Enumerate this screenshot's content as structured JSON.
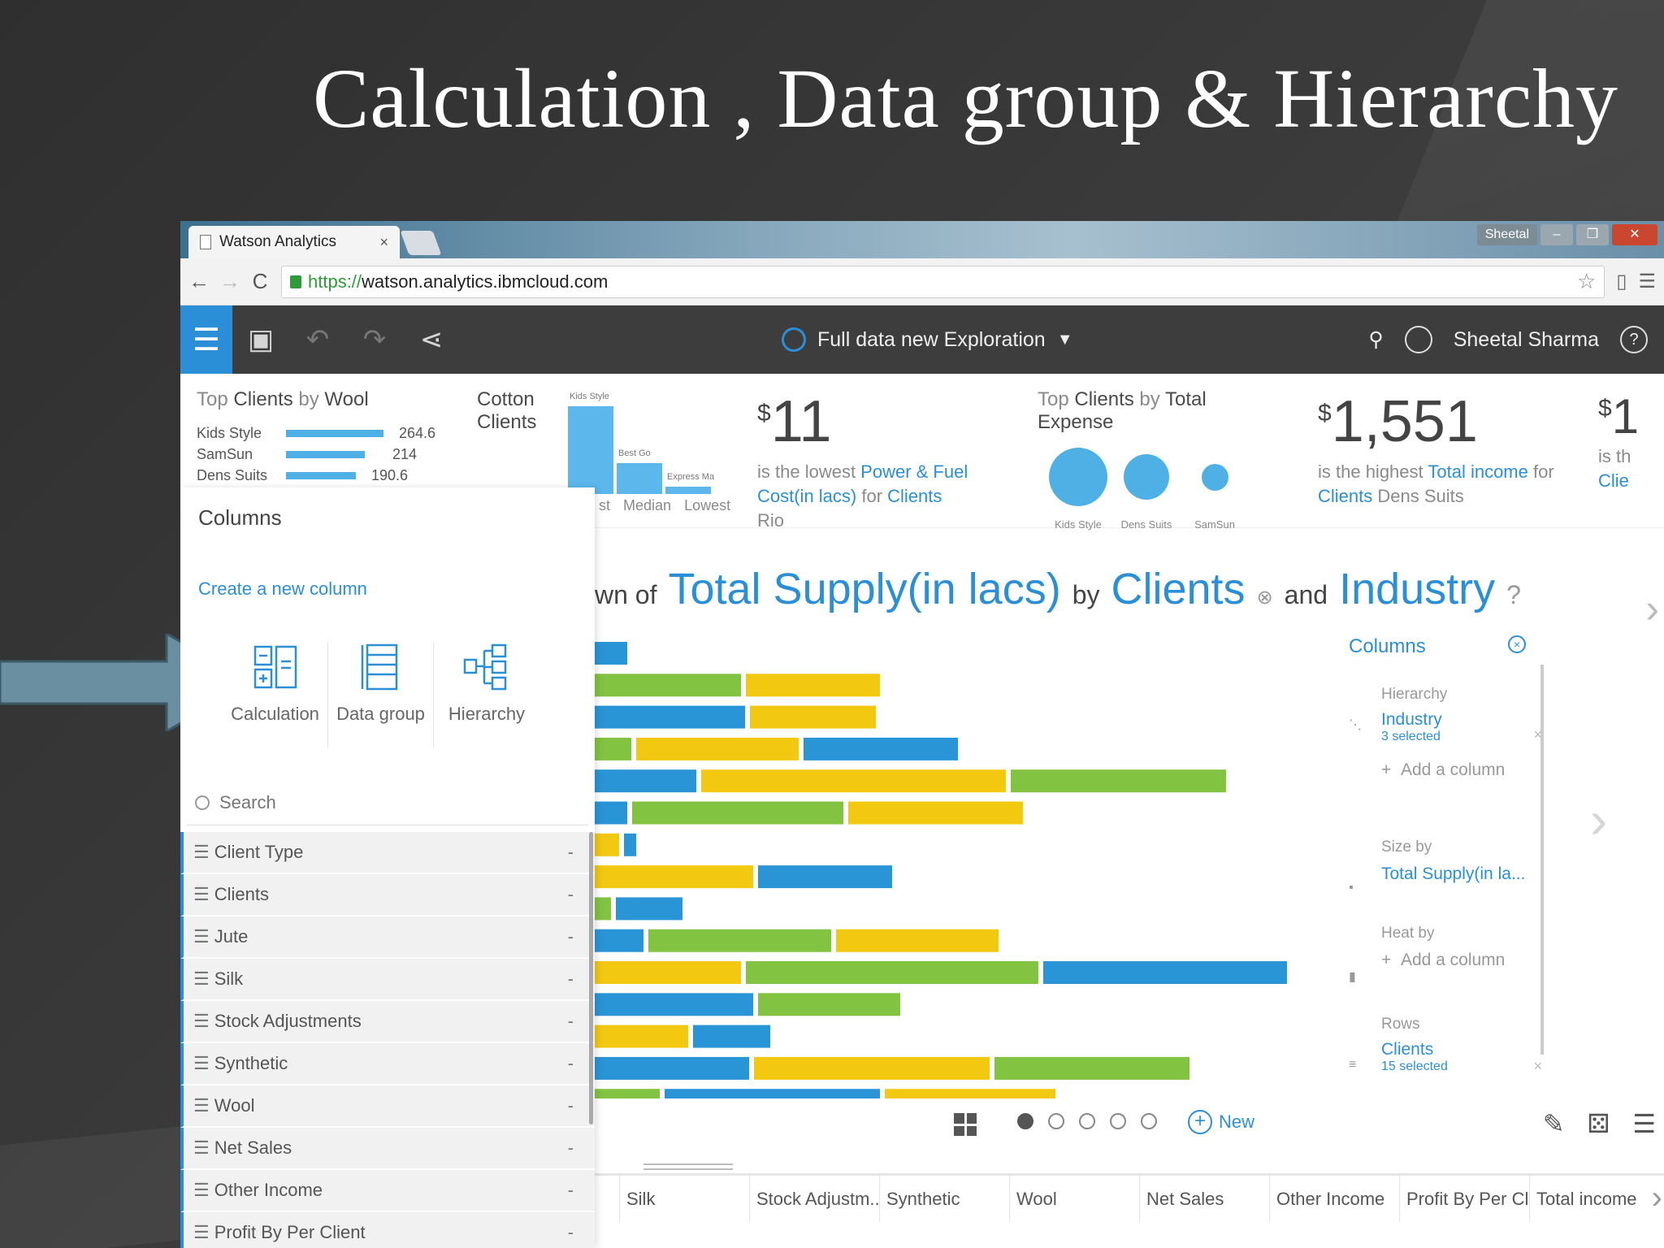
{
  "slide": {
    "title": "Calculation , Data group & Hierarchy"
  },
  "browser": {
    "tab_title": "Watson Analytics",
    "tab_close": "×",
    "user_badge": "Sheetal",
    "url_https": "https://",
    "url_rest": "watson.analytics.ibmcloud.com"
  },
  "header": {
    "exploration_title": "Full data new Exploration",
    "user_name": "Sheetal Sharma",
    "help": "?"
  },
  "insights": {
    "card1": {
      "title_pre": "Top ",
      "title_a": "Clients",
      "title_mid": " by ",
      "title_b": "Wool",
      "rows": [
        {
          "label": "Kids Style",
          "value": "264.6",
          "width": 1.0
        },
        {
          "label": "SamSun",
          "value": "214",
          "width": 0.81
        },
        {
          "label": "Dens Suits",
          "value": "190.6",
          "width": 0.72
        }
      ]
    },
    "card2": {
      "title_a": "Cotton",
      "title_mid": " by",
      "title_b": "Clients",
      "bars": [
        {
          "label": "Kids Style",
          "value": 1.0
        },
        {
          "label": "Best Go",
          "value": 0.35
        },
        {
          "label": "Express Ma",
          "value": 0.08
        }
      ],
      "axis": [
        "st",
        "Median",
        "Lowest"
      ]
    },
    "card3": {
      "symbol": "$",
      "value": "11",
      "text1": "is the lowest ",
      "measure1": "Power & Fuel",
      "measure2": "Cost(in lacs)",
      "text2": " for ",
      "dim": "Clients",
      "entity": " Rio"
    },
    "card4": {
      "title_pre": "Top ",
      "title_a": "Clients",
      "title_mid": " by ",
      "title_b": "Total Expense",
      "bubbles": [
        {
          "label": "Kids Style",
          "value": 1.0
        },
        {
          "label": "Dens Suits",
          "value": 0.7
        },
        {
          "label": "SamSun",
          "value": 0.25
        }
      ]
    },
    "card5": {
      "symbol": "$",
      "value": "1,551",
      "text1": "is the highest ",
      "measure": "Total income",
      "text2": " for",
      "dim": "Clients",
      "entity": " Dens Suits"
    },
    "card6": {
      "symbol": "$",
      "value": "1",
      "text1": "is th",
      "dim": "Clie"
    }
  },
  "left_panel": {
    "title": "Columns",
    "create_link": "Create a new column",
    "tools": [
      {
        "name": "calculation",
        "label": "Calculation"
      },
      {
        "name": "data-group",
        "label": "Data group"
      },
      {
        "name": "hierarchy",
        "label": "Hierarchy"
      }
    ],
    "search_placeholder": "Search",
    "columns": [
      "Client Type",
      "Clients",
      "Jute",
      "Silk",
      "Stock Adjustments",
      "Synthetic",
      "Wool",
      "Net Sales",
      "Other Income",
      "Profit By Per Client"
    ]
  },
  "question": {
    "prefix": "wn of",
    "measure": "Total Supply(in lacs)",
    "by": "by",
    "dim1": "Clients",
    "remove": "⊗",
    "and": "and",
    "dim2": "Industry",
    "q": "?"
  },
  "colors": {
    "blue": "#2b8fd8",
    "bar_blue": "#2a95d6",
    "bar_green": "#82c341",
    "bar_yellow": "#f2c811"
  },
  "chart_data": {
    "type": "bar",
    "orientation": "horizontal-stacked",
    "note_visible": "bars partially hidden behind the left panel",
    "rows": [
      [
        {
          "c": "blue",
          "v": 40
        }
      ],
      [
        {
          "c": "green",
          "v": 180
        },
        {
          "c": "yellow",
          "v": 165
        }
      ],
      [
        {
          "c": "blue",
          "v": 185
        },
        {
          "c": "yellow",
          "v": 155
        }
      ],
      [
        {
          "c": "green",
          "v": 45
        },
        {
          "c": "yellow",
          "v": 200
        },
        {
          "c": "blue",
          "v": 190
        }
      ],
      [
        {
          "c": "blue",
          "v": 125
        },
        {
          "c": "yellow",
          "v": 375
        },
        {
          "c": "green",
          "v": 265
        }
      ],
      [
        {
          "c": "blue",
          "v": 40
        },
        {
          "c": "green",
          "v": 260
        },
        {
          "c": "yellow",
          "v": 215
        }
      ],
      [
        {
          "c": "yellow",
          "v": 30
        },
        {
          "c": "blue",
          "v": 15
        }
      ],
      [
        {
          "c": "yellow",
          "v": 195
        },
        {
          "c": "blue",
          "v": 165
        }
      ],
      [
        {
          "c": "green",
          "v": 20
        },
        {
          "c": "blue",
          "v": 82
        }
      ],
      [
        {
          "c": "blue",
          "v": 60
        },
        {
          "c": "green",
          "v": 225
        },
        {
          "c": "yellow",
          "v": 200
        }
      ],
      [
        {
          "c": "yellow",
          "v": 180
        },
        {
          "c": "green",
          "v": 360
        },
        {
          "c": "blue",
          "v": 300
        }
      ],
      [
        {
          "c": "blue",
          "v": 195
        },
        {
          "c": "green",
          "v": 175
        }
      ],
      [
        {
          "c": "yellow",
          "v": 115
        },
        {
          "c": "blue",
          "v": 95
        }
      ],
      [
        {
          "c": "blue",
          "v": 190
        },
        {
          "c": "yellow",
          "v": 290
        },
        {
          "c": "green",
          "v": 240
        }
      ],
      [
        {
          "c": "green",
          "v": 80
        },
        {
          "c": "blue",
          "v": 265
        },
        {
          "c": "yellow",
          "v": 210
        }
      ]
    ]
  },
  "config": {
    "title": "Columns",
    "hierarchy_label": "Hierarchy",
    "hierarchy_value": "Industry",
    "hierarchy_sub": "3 selected",
    "add_column": "Add a column",
    "size_label": "Size by",
    "size_value": "Total Supply(in la...",
    "heat_label": "Heat by",
    "heat_add": "Add a column",
    "rows_label": "Rows",
    "rows_value": "Clients",
    "rows_sub": "15 selected"
  },
  "bottom": {
    "new_label": "New",
    "pages": 5,
    "active_page": 0
  },
  "table": {
    "headers": [
      "",
      "Silk",
      "Stock Adjustm...",
      "Synthetic",
      "Wool",
      "Net Sales",
      "Other Income",
      "Profit By Per Cl...",
      "Total income"
    ]
  }
}
